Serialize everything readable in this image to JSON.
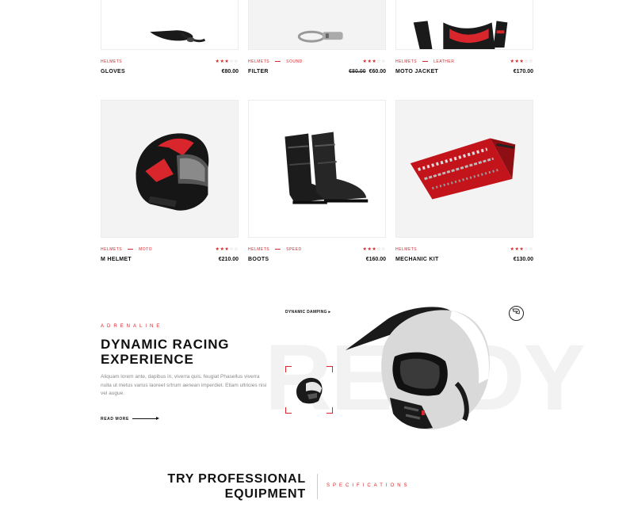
{
  "colors": {
    "accent": "#d8262c",
    "text": "#111111",
    "muted": "#8a8a8a",
    "tile": "#f3f3f3"
  },
  "products": [
    {
      "categories": [
        "Helmets"
      ],
      "name": "Gloves",
      "price": "€80.00",
      "old_price": "",
      "rating": 3,
      "rating_max": 5,
      "image": "gloves"
    },
    {
      "categories": [
        "Helmets",
        "Sound"
      ],
      "name": "Filter",
      "price": "€60.00",
      "old_price": "€80.00",
      "rating": 3,
      "rating_max": 5,
      "image": "filter"
    },
    {
      "categories": [
        "Helmets",
        "Leather"
      ],
      "name": "Moto Jacket",
      "price": "€170.00",
      "old_price": "",
      "rating": 3,
      "rating_max": 5,
      "image": "jacket"
    },
    {
      "categories": [
        "Helmets",
        "Moto"
      ],
      "name": "M Helmet",
      "price": "€210.00",
      "old_price": "",
      "rating": 3,
      "rating_max": 5,
      "image": "helmet"
    },
    {
      "categories": [
        "Helmets",
        "Speed"
      ],
      "name": "Boots",
      "price": "€160.00",
      "old_price": "",
      "rating": 3,
      "rating_max": 5,
      "image": "boots"
    },
    {
      "categories": [
        "Helmets"
      ],
      "name": "Mechanic Kit",
      "price": "€130.00",
      "old_price": "",
      "rating": 3,
      "rating_max": 5,
      "image": "toolkit"
    }
  ],
  "feature": {
    "kicker": "Adrenaline",
    "title_line1": "Dynamic Racing",
    "title_line2": "Experience",
    "body": "Aliquam lorem ante, dapibus in, viverra quis, feugiat Phasellus viverra nulla ut metus varius laoreet srtrum aenean imperdiet. Etiam ultricies nisi vel augue.",
    "read_more": "Read More",
    "ghost_text": "READY",
    "hotspot_label": "Dynamic Damping",
    "hotspot_arrow": "▸"
  },
  "equipment": {
    "title_line1": "Try Professional",
    "title_line2": "Equipment",
    "tab": "Specifications"
  }
}
